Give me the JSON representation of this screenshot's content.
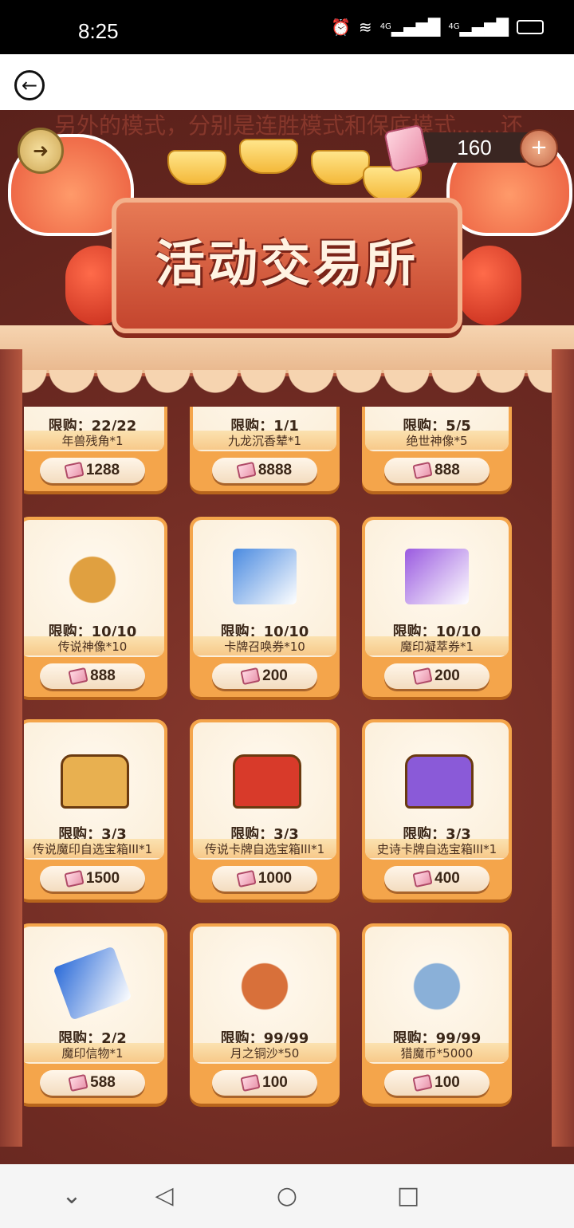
{
  "status_bar": {
    "time": "8:25",
    "icons": [
      "alarm-icon",
      "wifi-icon",
      "signal-4g-icon",
      "signal-4g-icon",
      "battery-icon"
    ],
    "net1": "4G",
    "net2": "4G"
  },
  "top_bar": {
    "back_icon": "back-arrow-icon"
  },
  "game": {
    "bg_text": "…另外的模式，分别是连胜模式和保底模式……还需……",
    "title": "活动交易所",
    "currency": {
      "amount": "160",
      "plus": "+"
    },
    "items": [
      {
        "limit": "限购：22/22",
        "name": "年兽残角*1",
        "price": "1288",
        "art": "horn"
      },
      {
        "limit": "限购：1/1",
        "name": "九龙沉香辇*1",
        "price": "8888",
        "art": "cart"
      },
      {
        "limit": "限购：5/5",
        "name": "绝世神像*5",
        "price": "888",
        "art": "statue"
      },
      {
        "limit": "限购：10/10",
        "name": "传说神像*10",
        "price": "888",
        "art": "statues"
      },
      {
        "limit": "限购：10/10",
        "name": "卡牌召唤券*10",
        "price": "200",
        "art": "cards"
      },
      {
        "limit": "限购：10/10",
        "name": "魔印凝萃券*1",
        "price": "200",
        "art": "ticket"
      },
      {
        "limit": "限购：3/3",
        "name": "传说魔印自选宝箱III*1",
        "price": "1500",
        "art": "chest-gold"
      },
      {
        "limit": "限购：3/3",
        "name": "传说卡牌自选宝箱III*1",
        "price": "1000",
        "art": "chest-red"
      },
      {
        "limit": "限购：3/3",
        "name": "史诗卡牌自选宝箱III*1",
        "price": "400",
        "art": "chest-purple"
      },
      {
        "limit": "限购：2/2",
        "name": "魔印信物*1",
        "price": "588",
        "art": "crystal"
      },
      {
        "limit": "限购：99/99",
        "name": "月之铜沙*50",
        "price": "100",
        "art": "sand"
      },
      {
        "limit": "限购：99/99",
        "name": "猎魔币*5000",
        "price": "100",
        "art": "coins"
      }
    ]
  },
  "nav_bar": {
    "back": "back-triangle-icon",
    "home": "home-circle-icon",
    "recents": "recents-square-icon",
    "menu": "chevron-down-icon"
  },
  "colors": {
    "card": "#f4a54b",
    "panel_bg": "#6d2a22",
    "accent": "#e77a55"
  }
}
